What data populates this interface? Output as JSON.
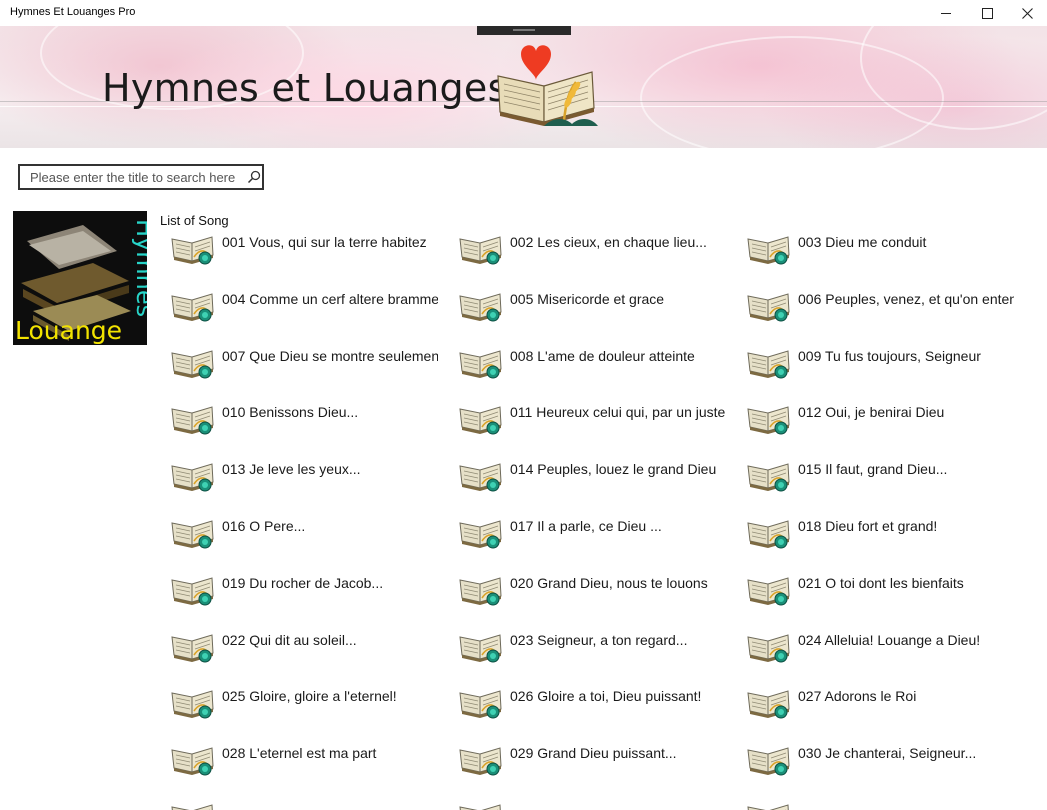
{
  "window": {
    "title": "Hymnes Et Louanges Pro"
  },
  "header": {
    "title": "Hymnes et Louanges"
  },
  "search": {
    "placeholder": "Please enter the title to search here"
  },
  "side_image": {
    "line1": "Hymnes",
    "line2": "Louange"
  },
  "list": {
    "label": "List of Song",
    "songs": [
      "001 Vous, qui sur la terre habitez",
      "002 Les cieux, en chaque lieu...",
      "003  Dieu me conduit",
      "004  Comme un cerf altere bramme",
      "005  Misericorde et grace",
      "006  Peuples, venez, et qu'on enten",
      "007  Que Dieu se montre seulemen",
      "008  L'ame de douleur atteinte",
      "009  Tu fus toujours, Seigneur",
      "010  Benissons Dieu...",
      "011  Heureux celui qui, par un juste",
      "012  Oui, je benirai Dieu",
      "013  Je leve les yeux...",
      "014  Peuples, louez le grand Dieu",
      "015  Il faut, grand Dieu...",
      "016  O Pere...",
      "017  Il a parle, ce Dieu ...",
      "018  Dieu fort et grand!",
      "019  Du rocher de Jacob...",
      "020  Grand Dieu, nous te louons",
      "021  O toi dont les bienfaits",
      "022  Qui dit au soleil...",
      "023  Seigneur, a ton regard...",
      "024  Alleluia! Louange a Dieu!",
      "025  Gloire, gloire a l'eternel!",
      "026  Gloire a toi, Dieu puissant!",
      "027  Adorons le Roi",
      "028  L'eternel est ma part",
      "029  Grand Dieu puissant...",
      "030  Je chanterai, Seigneur..."
    ]
  }
}
